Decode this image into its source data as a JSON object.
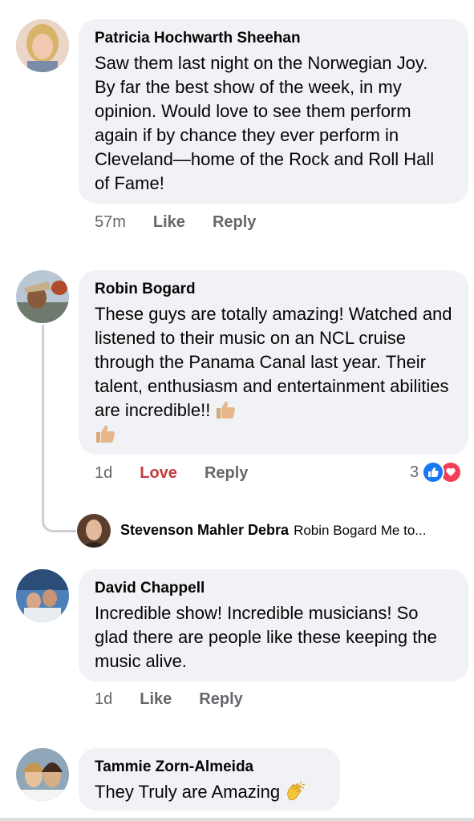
{
  "comments": [
    {
      "author": "Patricia Hochwarth Sheehan",
      "text": "Saw them last night on the Norwegian Joy. By far the best show of the week, in my opinion. Would love to see them perform again if by chance they ever perform in Cleveland—home of the Rock and Roll Hall of Fame!",
      "time": "57m",
      "like_label": "Like",
      "reply_label": "Reply"
    },
    {
      "author": "Robin Bogard",
      "text": "These guys are totally amazing!  Watched and listened to their music on an NCL cruise through the Panama Canal last year. Their talent, enthusiasm and entertainment abilities are incredible!!",
      "time": "1d",
      "like_label": "Love",
      "reply_label": "Reply",
      "reaction_count": "3",
      "reply": {
        "author": "Stevenson Mahler Debra",
        "text": "Robin Bogard Me to..."
      }
    },
    {
      "author": "David Chappell",
      "text": "Incredible show! Incredible musicians! So glad there are people like these keeping the music alive.",
      "time": "1d",
      "like_label": "Like",
      "reply_label": "Reply"
    },
    {
      "author": "Tammie Zorn-Almeida",
      "text": "They Truly are Amazing"
    }
  ],
  "colors": {
    "bubble": "#f0f2f5",
    "love": "#c43b3b",
    "like_reaction": "#1877f2",
    "love_reaction": "#f33e58",
    "muted": "#65676b"
  }
}
